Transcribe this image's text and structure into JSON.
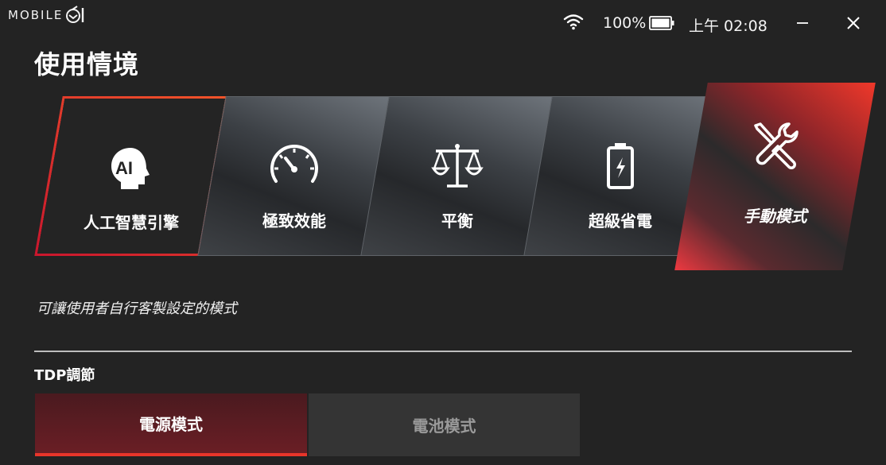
{
  "brand": {
    "name": "MOBILE"
  },
  "status": {
    "battery_percent": "100%",
    "clock": "上午 02:08"
  },
  "icons": {
    "wifi": "wifi-icon",
    "battery": "battery-icon",
    "minimize": "minimize-icon",
    "close": "close-icon",
    "ai": "ai-head-icon",
    "performance": "speedometer-icon",
    "balanced": "balance-scale-icon",
    "saver": "battery-charging-icon",
    "manual": "tools-icon"
  },
  "colors": {
    "accent": "#e8352a",
    "background": "#232323"
  },
  "page": {
    "title": "使用情境"
  },
  "modes": [
    {
      "label": "人工智慧引擎"
    },
    {
      "label": "極致效能"
    },
    {
      "label": "平衡"
    },
    {
      "label": "超級省電"
    },
    {
      "label": "手動模式"
    }
  ],
  "selected_mode": "手動模式",
  "description": "可讓使用者自行客製設定的模式",
  "tdp": {
    "title": "TDP調節",
    "options": [
      "電源模式",
      "電池模式"
    ],
    "selected": "電源模式"
  }
}
